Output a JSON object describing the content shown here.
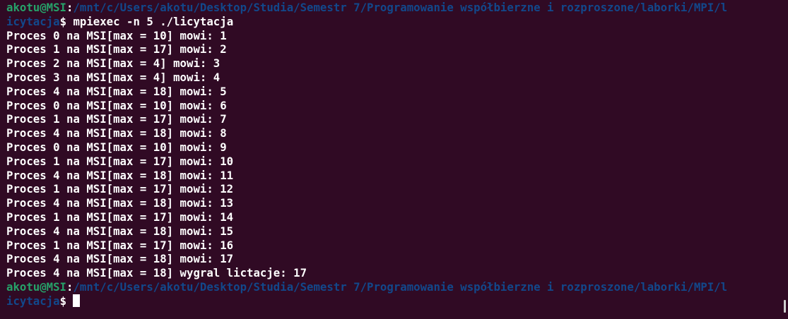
{
  "prompt1": {
    "user": "akotu@MSI",
    "sep": ":",
    "path_line1": "/mnt/c/Users/akotu/Desktop/Studia/Semestr 7/Programowanie współbierzne i rozproszone/laborki/MPI/l",
    "path_line2": "icytacja",
    "symbol": "$",
    "command": " mpiexec -n 5 ./licytacja"
  },
  "output": [
    "Proces 0 na MSI[max = 10] mowi: 1",
    "Proces 1 na MSI[max = 17] mowi: 2",
    "Proces 2 na MSI[max = 4] mowi: 3",
    "Proces 3 na MSI[max = 4] mowi: 4",
    "Proces 4 na MSI[max = 18] mowi: 5",
    "Proces 0 na MSI[max = 10] mowi: 6",
    "Proces 1 na MSI[max = 17] mowi: 7",
    "Proces 4 na MSI[max = 18] mowi: 8",
    "Proces 0 na MSI[max = 10] mowi: 9",
    "Proces 1 na MSI[max = 17] mowi: 10",
    "Proces 4 na MSI[max = 18] mowi: 11",
    "Proces 1 na MSI[max = 17] mowi: 12",
    "Proces 4 na MSI[max = 18] mowi: 13",
    "Proces 1 na MSI[max = 17] mowi: 14",
    "Proces 4 na MSI[max = 18] mowi: 15",
    "Proces 1 na MSI[max = 17] mowi: 16",
    "Proces 4 na MSI[max = 18] mowi: 17",
    "Proces 4 na MSI[max = 18] wygral lictacje: 17"
  ],
  "prompt2": {
    "user": "akotu@MSI",
    "sep": ":",
    "path_line1": "/mnt/c/Users/akotu/Desktop/Studia/Semestr 7/Programowanie współbierzne i rozproszone/laborki/MPI/l",
    "path_line2": "icytacja",
    "symbol": "$",
    "command": " "
  },
  "colors": {
    "background": "#300a24",
    "user_host": "#26a269",
    "path": "#12488b",
    "text": "#ffffff"
  }
}
